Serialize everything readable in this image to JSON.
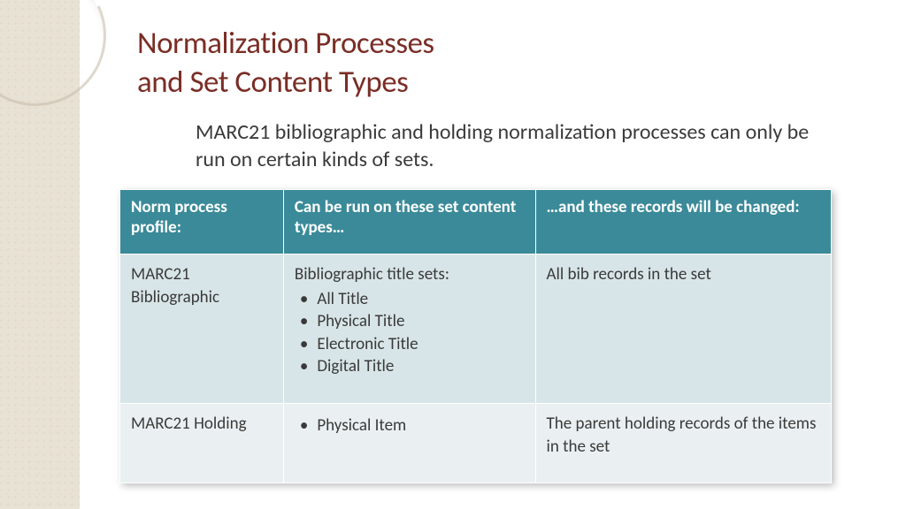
{
  "title_line1": "Normalization Processes",
  "title_line2": "and Set Content Types",
  "subtitle": "MARC21 bibliographic and holding normalization processes can only be run on certain kinds of sets.",
  "headers": {
    "c1": "Norm process profile:",
    "c2": "Can be run on these set content types…",
    "c3": "…and these records will be changed:"
  },
  "rows": [
    {
      "profile": "MARC21 Bibliographic",
      "set_intro": "Bibliographic title sets:",
      "set_items": [
        "All Title",
        "Physical Title",
        "Electronic Title",
        "Digital Title"
      ],
      "changed": "All bib records in the set"
    },
    {
      "profile": "MARC21 Holding",
      "set_intro": "",
      "set_items": [
        "Physical Item"
      ],
      "changed": "The parent holding records of the items in the set"
    }
  ]
}
